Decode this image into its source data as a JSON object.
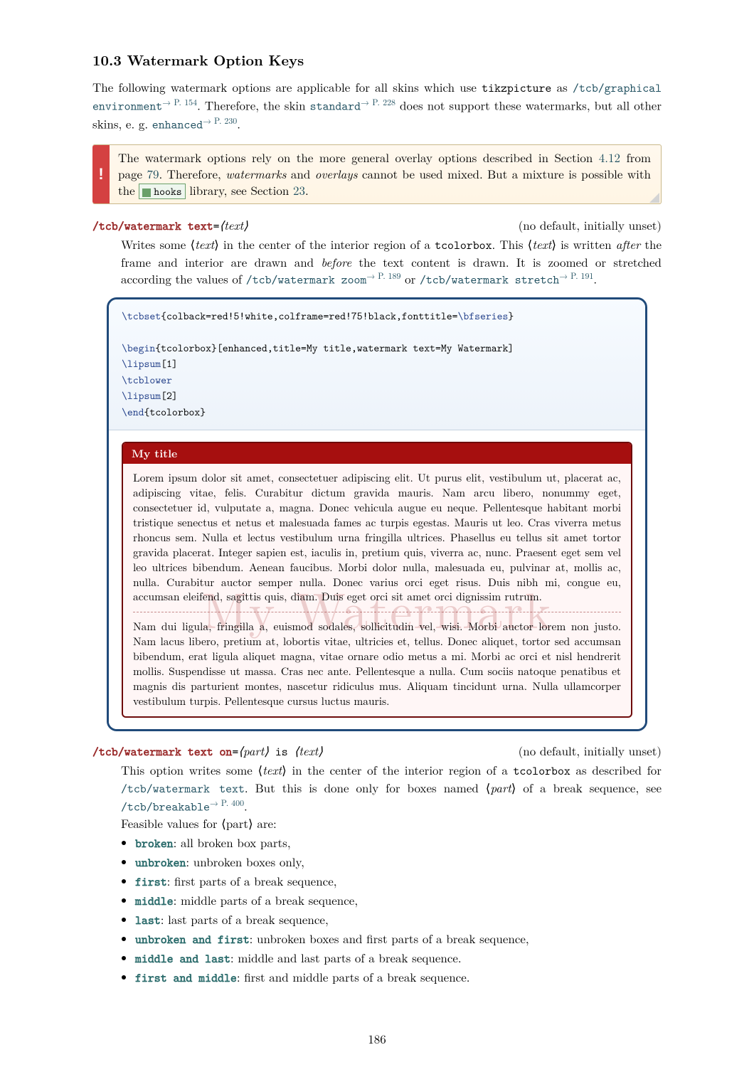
{
  "heading": "10.3   Watermark Option Keys",
  "intro1a": "The following watermark options are applicable for all skins which use ",
  "intro_tikz": "tikzpicture",
  "intro1b": " as ",
  "ref_graphical": "/tcb/graphical environment",
  "ref_graphical_page": "→ P. 154",
  "intro2a": ". Therefore, the skin ",
  "ref_standard": "standard",
  "ref_standard_page": "→ P. 228",
  "intro2b": " does not support these watermarks, but all other skins, e. g. ",
  "ref_enhanced": "enhanced",
  "ref_enhanced_page": "→ P. 230",
  "intro2c": ".",
  "excl": "!",
  "note_a": "The watermark options rely on the more general overlay options described in Section ",
  "note_sec412": "4.12",
  "note_b": " from page ",
  "note_page79": "79",
  "note_c": ". Therefore, ",
  "note_wm": "watermarks",
  "note_d": " and ",
  "note_ov": "overlays",
  "note_e": " cannot be used mixed. But a mixture is possible with the ",
  "lib_hooks": "hooks",
  "note_f": " library, see Section ",
  "note_sec23": "23",
  "note_g": ".",
  "key1_name": "/tcb/watermark text",
  "key1_eq": "=",
  "key1_arg": "⟨text⟩",
  "key1_default": "(no default, initially unset)",
  "key1_desc_a": "Writes some ⟨",
  "key1_desc_text1": "text",
  "key1_desc_b": "⟩ in the center of the interior region of a ",
  "key1_tcol": "tcolorbox",
  "key1_desc_c": ". This ⟨",
  "key1_desc_text2": "text",
  "key1_desc_d": "⟩ is written ",
  "key1_after": "after",
  "key1_desc_e": " the frame and interior are drawn and ",
  "key1_before": "before",
  "key1_desc_f": " the text content is drawn. It is zoomed or stretched according the values of ",
  "ref_wzoom": "/tcb/watermark zoom",
  "ref_wzoom_page": "→ P. 189",
  "key1_desc_g": " or ",
  "ref_wstretch": "/tcb/watermark stretch",
  "ref_wstretch_page": "→ P. 191",
  "key1_desc_h": ".",
  "code_l1a": "\\tcbset",
  "code_l1b": "{colback=red!5!white,colframe=red!75!black,fonttitle=",
  "code_l1c": "\\bfseries",
  "code_l1d": "}",
  "code_blank": "",
  "code_l2a": "\\begin",
  "code_l2b": "{tcolorbox}[enhanced,title=My title,watermark text=My Watermark]",
  "code_l3a": "\\lipsum",
  "code_l3b": "[1]",
  "code_l4": "\\tcblower",
  "code_l5a": "\\lipsum",
  "code_l5b": "[2]",
  "code_l6a": "\\end",
  "code_l6b": "{tcolorbox}",
  "ex_title": "My title",
  "watermark": "My Watermark",
  "lipsum1": "Lorem ipsum dolor sit amet, consectetuer adipiscing elit. Ut purus elit, vestibulum ut, placerat ac, adipiscing vitae, felis. Curabitur dictum gravida mauris. Nam arcu libero, nonummy eget, consectetuer id, vulputate a, magna. Donec vehicula augue eu neque. Pellentesque habitant morbi tristique senectus et netus et malesuada fames ac turpis egestas. Mauris ut leo. Cras viverra metus rhoncus sem. Nulla et lectus vestibulum urna fringilla ultrices. Phasellus eu tellus sit amet tortor gravida placerat. Integer sapien est, iaculis in, pretium quis, viverra ac, nunc. Praesent eget sem vel leo ultrices bibendum. Aenean faucibus. Morbi dolor nulla, malesuada eu, pulvinar at, mollis ac, nulla. Curabitur auctor semper nulla. Donec varius orci eget risus. Duis nibh mi, congue eu, accumsan eleifend, sagittis quis, diam. Duis eget orci sit amet orci dignissim rutrum.",
  "lipsum2": "Nam dui ligula, fringilla a, euismod sodales, sollicitudin vel, wisi. Morbi auctor lorem non justo. Nam lacus libero, pretium at, lobortis vitae, ultricies et, tellus. Donec aliquet, tortor sed accumsan bibendum, erat ligula aliquet magna, vitae ornare odio metus a mi. Morbi ac orci et nisl hendrerit mollis. Suspendisse ut massa. Cras nec ante. Pellentesque a nulla. Cum sociis natoque penatibus et magnis dis parturient montes, nascetur ridiculus mus. Aliquam tincidunt urna. Nulla ullamcorper vestibulum turpis. Pellentesque cursus luctus mauris.",
  "key2_name": "/tcb/watermark text on",
  "key2_eq": "=",
  "key2_part": "⟨part⟩",
  "key2_is": " is ",
  "key2_text": "⟨text⟩",
  "key2_default": "(no default, initially unset)",
  "key2_desc_a": "This option writes some ⟨",
  "key2_desc_text": "text",
  "key2_desc_b": "⟩ in the center of the interior region of a ",
  "key2_tcol": "tcolorbox",
  "key2_desc_c": " as described for ",
  "ref_wtext": "/tcb/watermark text",
  "key2_desc_d": ". But this is done only for boxes named ⟨",
  "key2_desc_part": "part",
  "key2_desc_e": "⟩ of a break sequence, see ",
  "ref_breakable": "/tcb/breakable",
  "ref_breakable_page": "→ P. 400",
  "key2_desc_f": ".",
  "feasible": "Feasible values for ⟨part⟩ are:",
  "parts": [
    {
      "kw": "broken",
      "desc": ": all broken box parts,"
    },
    {
      "kw": "unbroken",
      "desc": ": unbroken boxes only,"
    },
    {
      "kw": "first",
      "desc": ": first parts of a break sequence,"
    },
    {
      "kw": "middle",
      "desc": ": middle parts of a break sequence,"
    },
    {
      "kw": "last",
      "desc": ": last parts of a break sequence,"
    },
    {
      "kw": "unbroken and first",
      "desc": ": unbroken boxes and first parts of a break sequence,"
    },
    {
      "kw": "middle and last",
      "desc": ": middle and last parts of a break sequence."
    },
    {
      "kw": "first and middle",
      "desc": ": first and middle parts of a break sequence."
    }
  ],
  "pagenum": "186"
}
